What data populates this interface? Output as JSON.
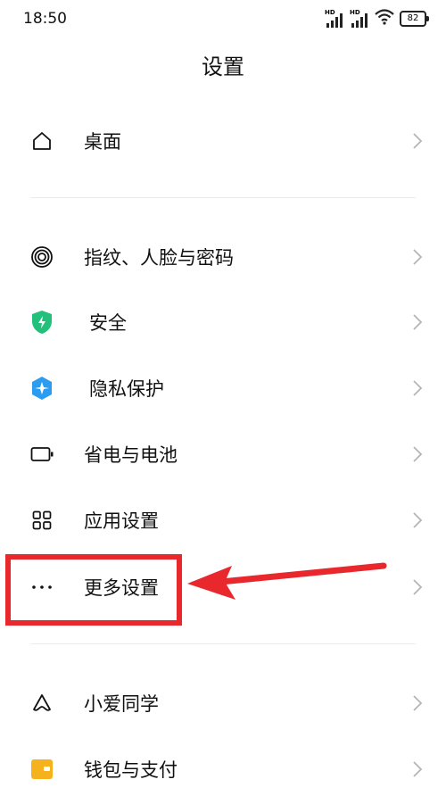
{
  "status_bar": {
    "time": "18:50",
    "battery": "82",
    "hd1": "HD",
    "hd2": "HD"
  },
  "page": {
    "title": "设置"
  },
  "items": [
    {
      "label": "桌面",
      "icon": "home-icon"
    },
    {
      "label": "指纹、人脸与密码",
      "icon": "fingerprint-icon"
    },
    {
      "label": "安全",
      "icon": "security-shield-icon",
      "color": "#22c07a"
    },
    {
      "label": "隐私保护",
      "icon": "privacy-icon",
      "color": "#2b9cf0"
    },
    {
      "label": "省电与电池",
      "icon": "battery-icon"
    },
    {
      "label": "应用设置",
      "icon": "apps-grid-icon"
    },
    {
      "label": "更多设置",
      "icon": "more-dots-icon"
    },
    {
      "label": "小爱同学",
      "icon": "xiaoai-icon"
    },
    {
      "label": "钱包与支付",
      "icon": "wallet-icon",
      "color": "#f5b21c"
    }
  ],
  "annotation": {
    "highlight_color": "#e8282c"
  }
}
